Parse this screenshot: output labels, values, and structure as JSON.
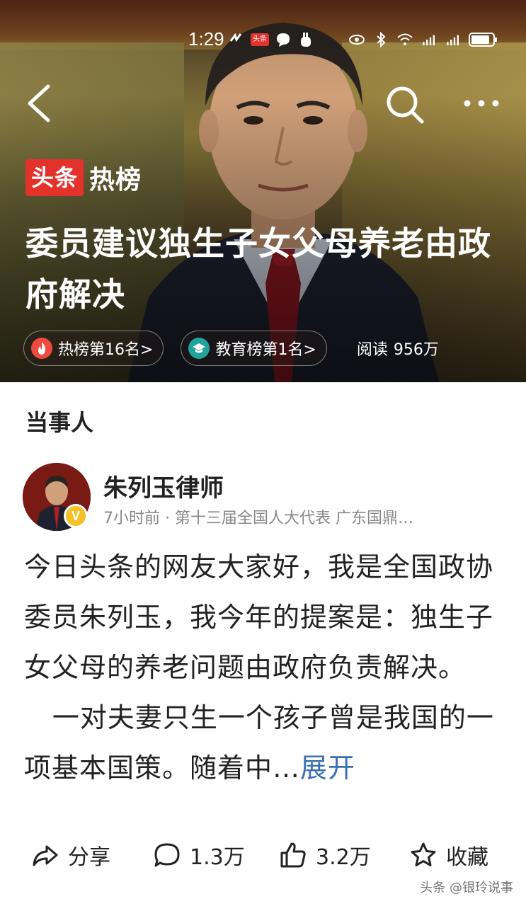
{
  "status_bar": {
    "time": "1:29",
    "app_badge": "头条"
  },
  "brand": {
    "toutiao": "头条",
    "rebang": "热榜"
  },
  "headline": "委员建议独生子女父母养老由政府解决",
  "pills": [
    {
      "label": "热榜第16名>"
    },
    {
      "label": "教育榜第1名>"
    }
  ],
  "reads": {
    "label": "阅读",
    "value": "956万"
  },
  "section_title": "当事人",
  "author": {
    "name": "朱列玉律师",
    "meta": "7小时前 · 第十三届全国人大代表 广东国鼎…",
    "badge": "V"
  },
  "body": {
    "p1": "今日头条的网友大家好，我是全国政协委员朱列玉，我今年的提案是：独生子女父母的养老问题由政府负责解决。",
    "p2": "一对夫妻只生一个孩子曾是我国的一项基本国策。随着中…",
    "expand": "展开"
  },
  "actions": {
    "share": "分享",
    "comment": "1.3万",
    "like": "3.2万",
    "favorite": "收藏"
  },
  "watermark": "头条 @银玲说事",
  "colors": {
    "brand_red": "#e3322c",
    "link_blue": "#3a6fb0",
    "badge_yellow": "#f4c026",
    "teal": "#1fa39a"
  }
}
